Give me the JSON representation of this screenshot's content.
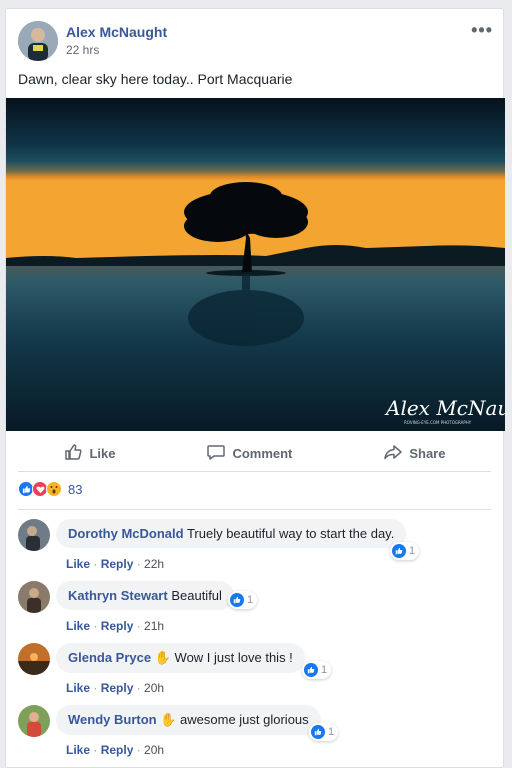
{
  "post": {
    "author": "Alex McNaught",
    "time": "22 hrs",
    "more": "•••",
    "caption": "Dawn, clear sky here today.. Port Macquarie",
    "watermark": "Alex McNaught",
    "watermark_sub": "ROVING-EYE.COM PHOTOGRAPHY"
  },
  "actions": {
    "like": "Like",
    "comment": "Comment",
    "share": "Share"
  },
  "reactions": {
    "count": "83",
    "icons": [
      "like-icon",
      "love-icon",
      "wow-icon"
    ]
  },
  "comments": [
    {
      "name": "Dorothy McDonald",
      "text": "Truely beautiful way to start the day.",
      "like": "Like",
      "reply": "Reply",
      "time": "22h",
      "reacts": "1"
    },
    {
      "name": "Kathryn Stewart",
      "text": "Beautiful",
      "like": "Like",
      "reply": "Reply",
      "time": "21h",
      "reacts": "1"
    },
    {
      "name": "Glenda Pryce",
      "text": " Wow I just love this !",
      "like": "Like",
      "reply": "Reply",
      "time": "20h",
      "reacts": "1"
    },
    {
      "name": "Wendy Burton",
      "text": " awesome just glorious",
      "like": "Like",
      "reply": "Reply",
      "time": "20h",
      "reacts": "1"
    }
  ],
  "colors": {
    "link": "#385898",
    "like_blue": "#1877f2",
    "love_red": "#f33e58",
    "wow_yellow": "#f7b125"
  }
}
